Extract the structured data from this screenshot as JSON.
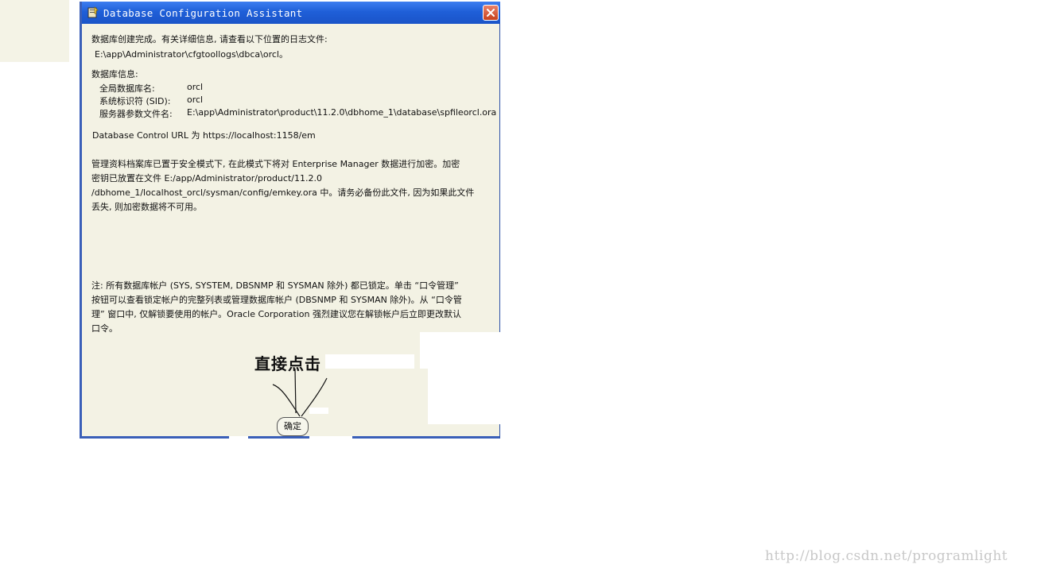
{
  "dialog": {
    "title": "Database Configuration Assistant",
    "completion_line1": "数据库创建完成。有关详细信息, 请查看以下位置的日志文件:",
    "log_path": "E:\\app\\Administrator\\cfgtoollogs\\dbca\\orcl。",
    "info_heading": "数据库信息:",
    "info": [
      {
        "label": "全局数据库名:",
        "value": "orcl"
      },
      {
        "label": "系统标识符 (SID):",
        "value": "orcl"
      },
      {
        "label": "服务器参数文件名:",
        "value": "E:\\app\\Administrator\\product\\11.2.0\\dbhome_1\\database\\spfileorcl.ora"
      }
    ],
    "control_url": "Database Control URL 为 https://localhost:1158/em",
    "secure_mode_paragraph": "管理资料档案库已置于安全模式下, 在此模式下将对 Enterprise Manager 数据进行加密。加密\n密钥已放置在文件 E:/app/Administrator/product/11.2.0\n/dbhome_1/localhost_orcl/sysman/config/emkey.ora 中。请务必备份此文件, 因为如果此文件\n丢失, 则加密数据将不可用。",
    "accounts_note": "注: 所有数据库帐户 (SYS, SYSTEM, DBSNMP 和 SYSMAN 除外) 都已锁定。单击 “口令管理”\n按钮可以查看锁定帐户的完整列表或管理数据库帐户 (DBSNMP 和 SYSMAN 除外)。从 “口令管\n理” 窗口中, 仅解锁要使用的帐户。Oracle Corporation 强烈建议您在解锁帐户后立即更改默认\n口令。",
    "ok_label": "确定"
  },
  "annotation": {
    "text": "直接点击"
  },
  "watermark": "http://blog.csdn.net/programlight",
  "colors": {
    "titlebar": "#1f5fd8",
    "dialog_bg": "#f3f2e4",
    "close_button": "#c7411c"
  },
  "icons": {
    "title": "dbca-app-icon",
    "close": "close-icon",
    "arrow": "hand-drawn-arrow"
  }
}
